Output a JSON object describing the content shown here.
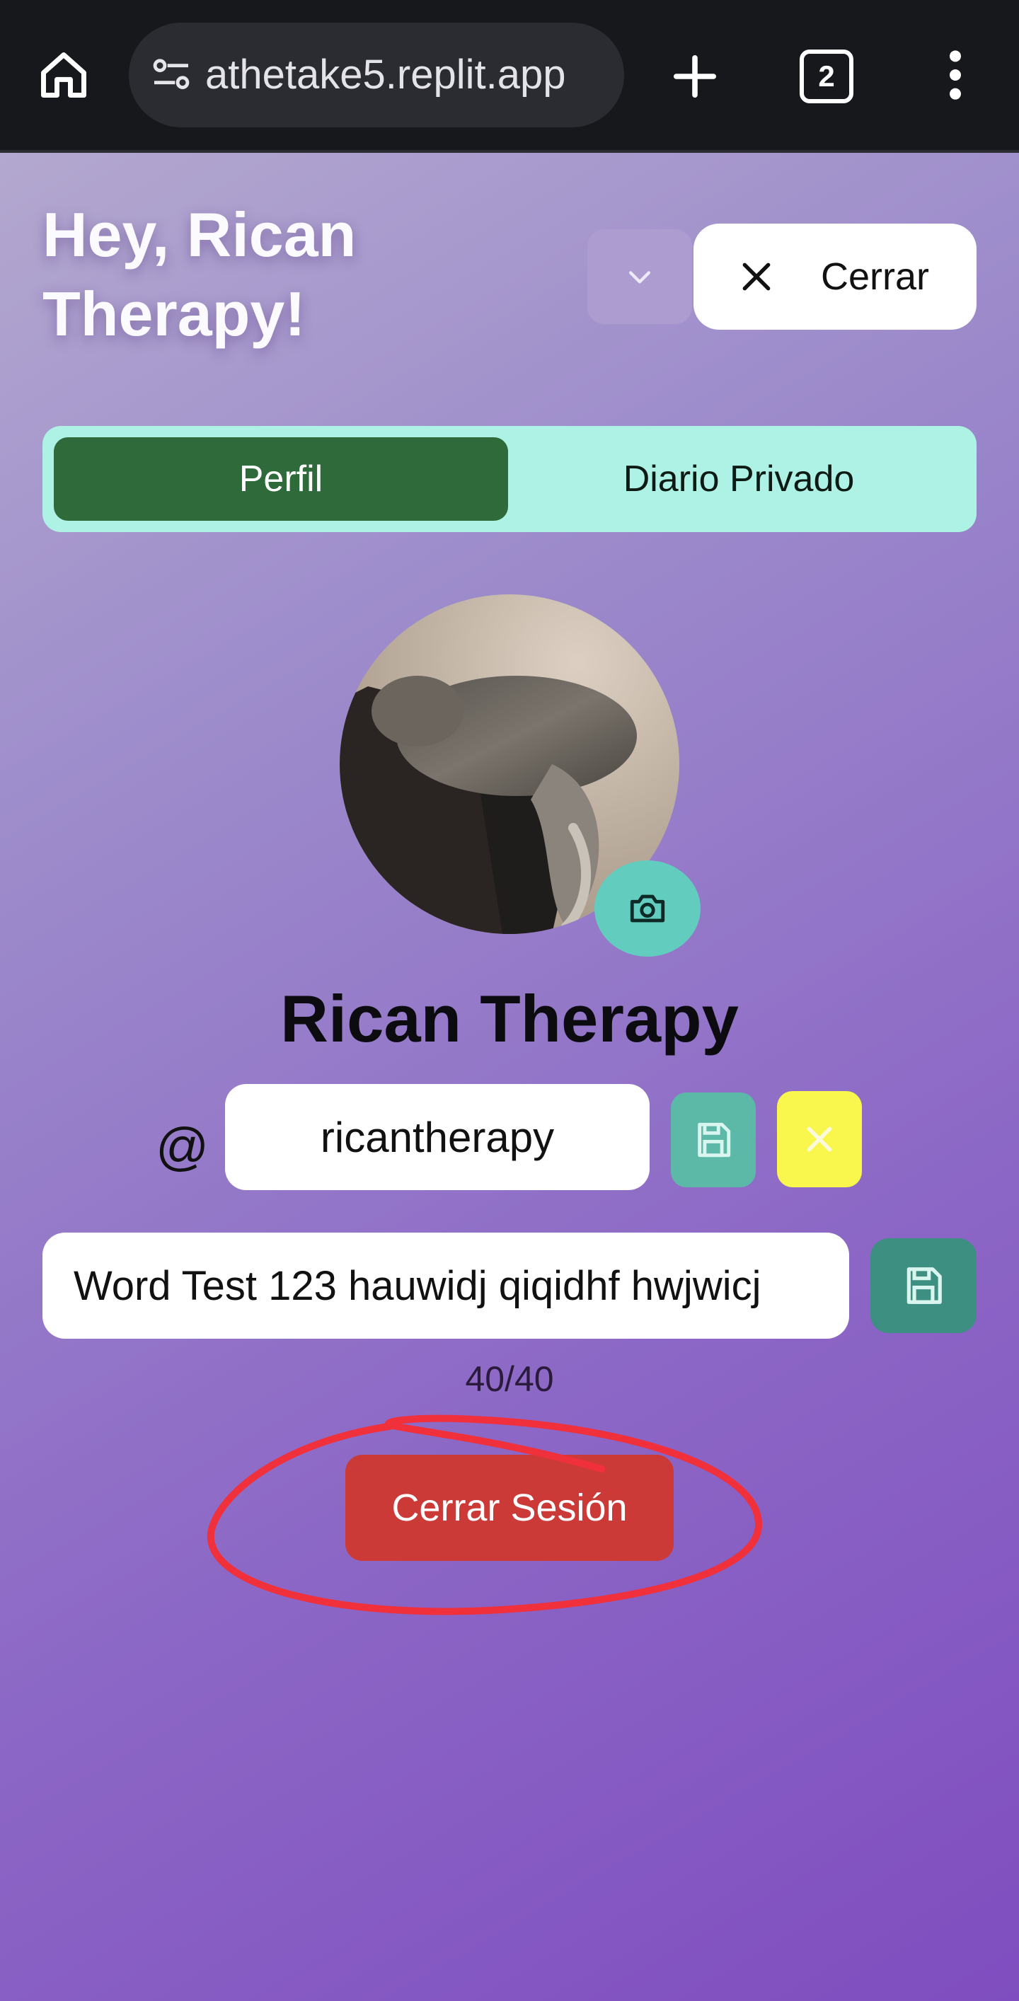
{
  "browser": {
    "url_text": "athetake5.replit.app",
    "tab_count": "2",
    "icons": [
      "home-icon",
      "site-info-icon",
      "new-tab-icon",
      "tab-switcher-icon",
      "more-menu-icon"
    ]
  },
  "header": {
    "greeting": "Hey, Rican Therapy!",
    "close_label": "Cerrar"
  },
  "tabs": [
    {
      "label": "Perfil",
      "active": true
    },
    {
      "label": "Diario Privado",
      "active": false
    }
  ],
  "profile": {
    "display_name": "Rican Therapy",
    "at_symbol": "@",
    "username_value": "ricantherapy",
    "bio_value": "Word Test 123 hauwidj qiqidhf hwjwicj",
    "char_count": "40/40",
    "logout_label": "Cerrar Sesión"
  },
  "colors": {
    "accent_green": "#2e6a3a",
    "tab_bg": "#aef2e5",
    "logout_red": "#cc3a37",
    "cancel_yellow": "#f9f74d",
    "annotation_red": "#f0303a"
  }
}
